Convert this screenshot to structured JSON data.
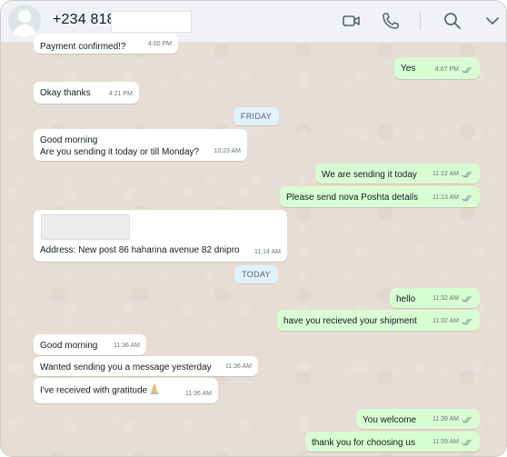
{
  "header": {
    "contact_name": "+234 818",
    "icons": [
      "video-call-icon",
      "voice-call-icon",
      "search-icon",
      "chevron-down-icon"
    ]
  },
  "messages": [
    {
      "dir": "in",
      "text": "Payment confirmed!?",
      "time": "4:00 PM"
    },
    {
      "dir": "out",
      "text": "Yes",
      "time": "4:07 PM"
    },
    {
      "dir": "in",
      "text": "Okay thanks",
      "time": "4:21 PM"
    },
    {
      "dir": "in",
      "line1": "Good morning",
      "line2": "Are you sending it today or till Monday?",
      "time": "10:23 AM"
    },
    {
      "dir": "out",
      "text": "We are sending it today",
      "time": "11:12 AM"
    },
    {
      "dir": "out",
      "text": "Please send nova Poshta details",
      "time": "11:13 AM"
    },
    {
      "dir": "in",
      "text": "Address: New post 86 haharina avenue 82 dnipro",
      "time": "11:14 AM"
    },
    {
      "dir": "out",
      "text": "hello",
      "time": "11:32 AM"
    },
    {
      "dir": "out",
      "text": "have you recieved your shipment",
      "time": "11:32 AM"
    },
    {
      "dir": "in",
      "text": "Good morning",
      "time": "11:36 AM"
    },
    {
      "dir": "in",
      "text": "Wanted sending you a message yesterday",
      "time": "11:36 AM"
    },
    {
      "dir": "in",
      "text": "I've received with gratitude",
      "time": "11:36 AM"
    },
    {
      "dir": "out",
      "text": "You welcome",
      "time": "11:39 AM"
    },
    {
      "dir": "out",
      "text": "thank you for choosing us",
      "time": "11:39 AM"
    }
  ],
  "day_labels": {
    "friday": "FRIDAY",
    "today": "TODAY"
  },
  "colors": {
    "outgoing": "#d9fdd3",
    "incoming": "#ffffff",
    "tick": "#8696a0",
    "chip": "#e1f2fb"
  }
}
